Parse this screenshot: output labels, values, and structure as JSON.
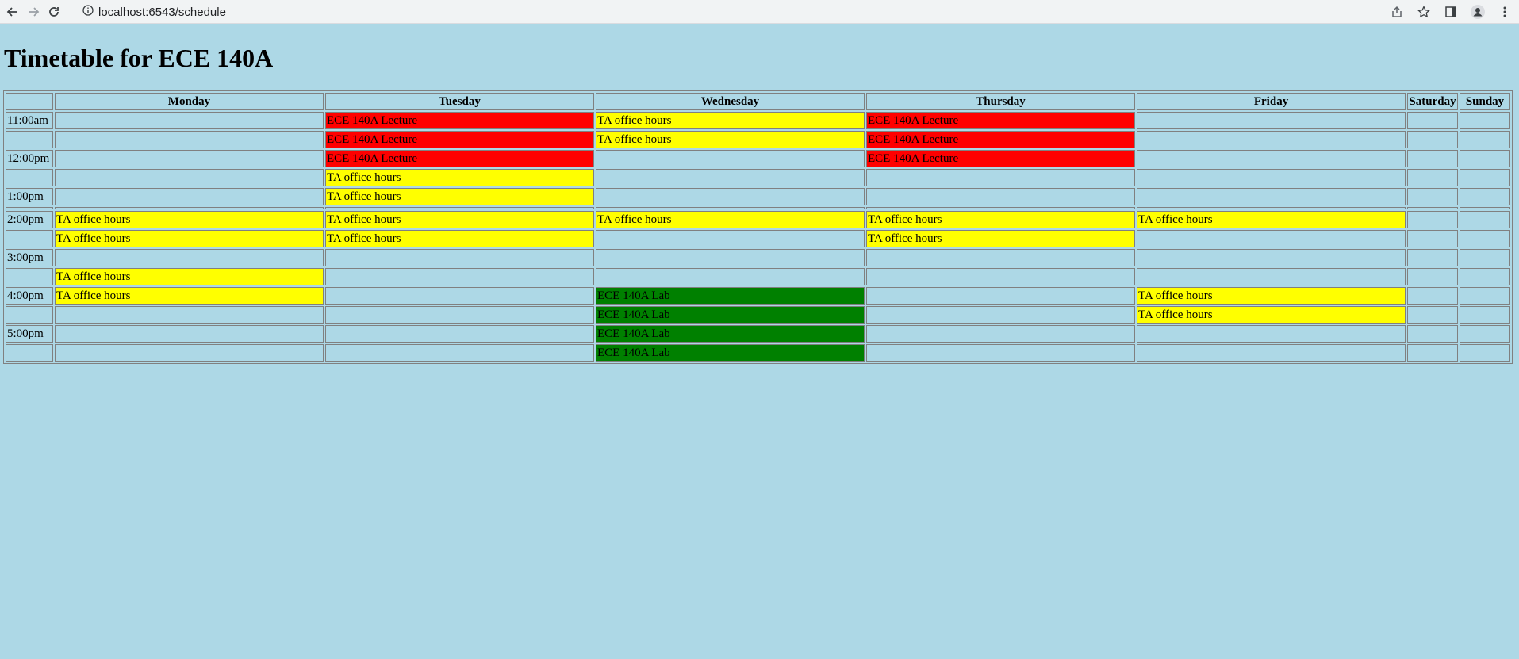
{
  "browser": {
    "url": "localhost:6543/schedule"
  },
  "page": {
    "title": "Timetable for ECE 140A"
  },
  "colors": {
    "background": "#add8e6",
    "lecture": "#ff0000",
    "ta_office_hours": "#ffff00",
    "lab": "#008000"
  },
  "table": {
    "headers": [
      "",
      "Monday",
      "Tuesday",
      "Wednesday",
      "Thursday",
      "Friday",
      "Saturday",
      "Sunday"
    ],
    "rows": [
      {
        "time": "11:00am",
        "cells": [
          "",
          "ECE 140A Lecture",
          "TA office hours",
          "ECE 140A Lecture",
          "",
          "",
          ""
        ]
      },
      {
        "time": "",
        "cells": [
          "",
          "ECE 140A Lecture",
          "TA office hours",
          "ECE 140A Lecture",
          "",
          "",
          ""
        ]
      },
      {
        "time": "12:00pm",
        "cells": [
          "",
          "ECE 140A Lecture",
          "",
          "ECE 140A Lecture",
          "",
          "",
          ""
        ]
      },
      {
        "time": "",
        "cells": [
          "",
          "TA office hours",
          "",
          "",
          "",
          "",
          ""
        ]
      },
      {
        "time": "1:00pm",
        "cells": [
          "",
          "TA office hours",
          "",
          "",
          "",
          "",
          ""
        ]
      },
      {
        "spacer": true,
        "time": "",
        "cells": [
          "",
          "",
          "",
          "",
          "",
          "",
          ""
        ]
      },
      {
        "time": "2:00pm",
        "cells": [
          "TA office hours",
          "TA office hours",
          "TA office hours",
          "TA office hours",
          "TA office hours",
          "",
          ""
        ]
      },
      {
        "time": "",
        "cells": [
          "TA office hours",
          "TA office hours",
          "",
          "TA office hours",
          "",
          "",
          ""
        ]
      },
      {
        "time": "3:00pm",
        "cells": [
          "",
          "",
          "",
          "",
          "",
          "",
          ""
        ]
      },
      {
        "time": "",
        "cells": [
          "TA office hours",
          "",
          "",
          "",
          "",
          "",
          ""
        ]
      },
      {
        "time": "4:00pm",
        "cells": [
          "TA office hours",
          "",
          "ECE 140A Lab",
          "",
          "TA office hours",
          "",
          ""
        ]
      },
      {
        "time": "",
        "cells": [
          "",
          "",
          "ECE 140A Lab",
          "",
          "TA office hours",
          "",
          ""
        ]
      },
      {
        "time": "5:00pm",
        "cells": [
          "",
          "",
          "ECE 140A Lab",
          "",
          "",
          "",
          ""
        ]
      },
      {
        "time": "",
        "cells": [
          "",
          "",
          "ECE 140A Lab",
          "",
          "",
          "",
          ""
        ]
      }
    ]
  }
}
